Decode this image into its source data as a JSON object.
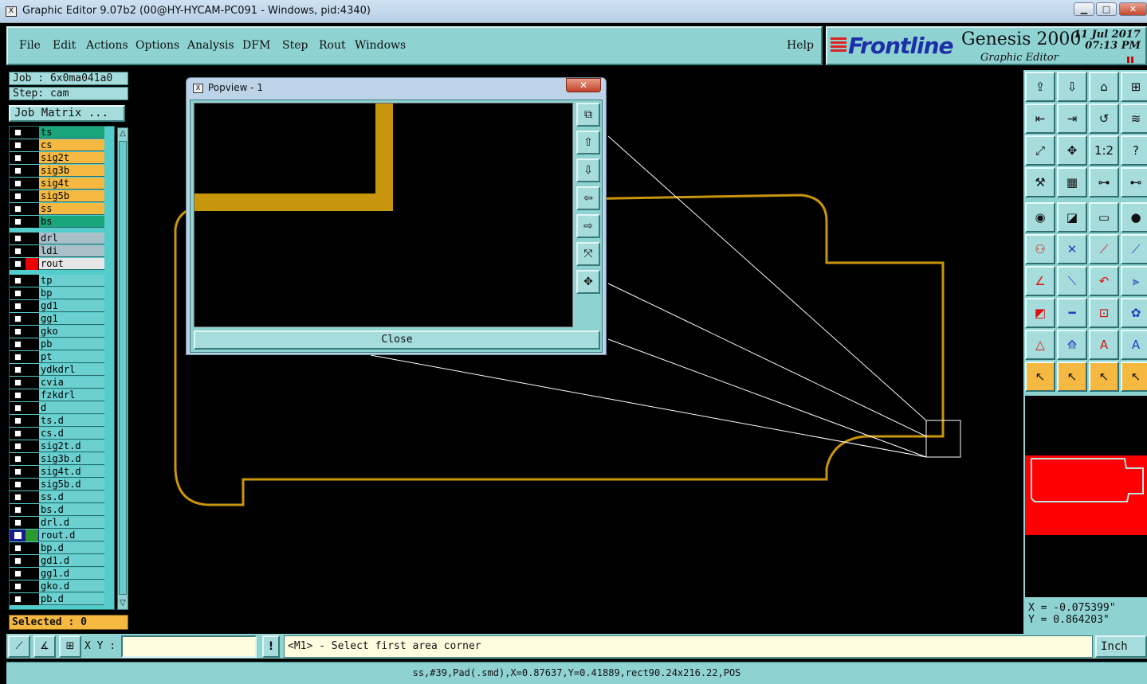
{
  "window": {
    "title": "Graphic Editor 9.07b2 (00@HY-HYCAM-PC091 - Windows, pid:4340)",
    "min_glyph": "▁",
    "max_glyph": "□",
    "close_glyph": "✕"
  },
  "menu": {
    "items": [
      "File",
      "Edit",
      "Actions",
      "Options",
      "Analysis",
      "DFM",
      "Step",
      "Rout",
      "Windows"
    ],
    "help": "Help"
  },
  "brand": {
    "logo": "Frontline",
    "product": "Genesis 2000",
    "subtitle": "Graphic Editor",
    "date": "11 Jul 2017",
    "time": "07:13 PM"
  },
  "job": {
    "job_label": "Job : 6x0ma041a0",
    "step_label": "Step: cam",
    "matrix_button": "Job Matrix ...",
    "selected": "Selected : 0"
  },
  "layers": [
    {
      "name": "ts",
      "color": "#1aa57a",
      "swatch": "#000"
    },
    {
      "name": "cs",
      "color": "#f5b942",
      "swatch": "#000"
    },
    {
      "name": "sig2t",
      "color": "#f5b942",
      "swatch": "#000"
    },
    {
      "name": "sig3b",
      "color": "#f5b942",
      "swatch": "#000"
    },
    {
      "name": "sig4t",
      "color": "#f5b942",
      "swatch": "#000"
    },
    {
      "name": "sig5b",
      "color": "#f5b942",
      "swatch": "#000"
    },
    {
      "name": "ss",
      "color": "#f5b942",
      "swatch": "#000"
    },
    {
      "name": "bs",
      "color": "#1aa57a",
      "swatch": "#000"
    },
    {
      "name": "drl",
      "color": "#a9c0c8",
      "swatch": "#000"
    },
    {
      "name": "ldi",
      "color": "#a9c0c8",
      "swatch": "#000"
    },
    {
      "name": "rout",
      "color": "#e6e6e6",
      "swatch": "#e00"
    },
    {
      "name": "tp",
      "color": "#6cd0d0",
      "swatch": "#000"
    },
    {
      "name": "bp",
      "color": "#6cd0d0",
      "swatch": "#000"
    },
    {
      "name": "gd1",
      "color": "#6cd0d0",
      "swatch": "#000"
    },
    {
      "name": "gg1",
      "color": "#6cd0d0",
      "swatch": "#000"
    },
    {
      "name": "gko",
      "color": "#6cd0d0",
      "swatch": "#000"
    },
    {
      "name": "pb",
      "color": "#6cd0d0",
      "swatch": "#000"
    },
    {
      "name": "pt",
      "color": "#6cd0d0",
      "swatch": "#000"
    },
    {
      "name": "ydkdrl",
      "color": "#6cd0d0",
      "swatch": "#000"
    },
    {
      "name": "cvia",
      "color": "#6cd0d0",
      "swatch": "#000"
    },
    {
      "name": "fzkdrl",
      "color": "#6cd0d0",
      "swatch": "#000"
    },
    {
      "name": "d",
      "color": "#6cd0d0",
      "swatch": "#000"
    },
    {
      "name": "ts.d",
      "color": "#6cd0d0",
      "swatch": "#000"
    },
    {
      "name": "cs.d",
      "color": "#6cd0d0",
      "swatch": "#000"
    },
    {
      "name": "sig2t.d",
      "color": "#6cd0d0",
      "swatch": "#000"
    },
    {
      "name": "sig3b.d",
      "color": "#6cd0d0",
      "swatch": "#000"
    },
    {
      "name": "sig4t.d",
      "color": "#6cd0d0",
      "swatch": "#000"
    },
    {
      "name": "sig5b.d",
      "color": "#6cd0d0",
      "swatch": "#000"
    },
    {
      "name": "ss.d",
      "color": "#6cd0d0",
      "swatch": "#000"
    },
    {
      "name": "bs.d",
      "color": "#6cd0d0",
      "swatch": "#000"
    },
    {
      "name": "drl.d",
      "color": "#6cd0d0",
      "swatch": "#000"
    },
    {
      "name": "rout.d",
      "color": "#6cd0d0",
      "swatch": "#2a9a2a",
      "active": true
    },
    {
      "name": "bp.d",
      "color": "#6cd0d0",
      "swatch": "#000"
    },
    {
      "name": "gd1.d",
      "color": "#6cd0d0",
      "swatch": "#000"
    },
    {
      "name": "gg1.d",
      "color": "#6cd0d0",
      "swatch": "#000"
    },
    {
      "name": "gko.d",
      "color": "#6cd0d0",
      "swatch": "#000"
    },
    {
      "name": "pb.d",
      "color": "#6cd0d0",
      "swatch": "#000"
    }
  ],
  "popview": {
    "title": "Popview - 1",
    "close_label": "Close",
    "close_x": "✕"
  },
  "coords": {
    "x": "X = -0.075399\"",
    "y": "Y =  0.864203\""
  },
  "bottom": {
    "xy_label": "X Y :",
    "xy_value": "",
    "bang": "!",
    "prompt": "<M1> - Select first area corner",
    "unit": "Inch"
  },
  "status": "ss,#39,Pad(.smd),X=0.87637,Y=0.41889,rect90.24x216.22,POS",
  "colors": {
    "panel": "#8fd2d2",
    "trace": "#c8960c",
    "layer_board": "#1aa57a",
    "layer_signal": "#f5b942",
    "minimap": "#ff0000"
  },
  "toolbar_icons": [
    "open-icon",
    "save-icon",
    "home-icon",
    "grid-icon",
    "prev-icon",
    "next-icon",
    "undo-icon",
    "snap-icon",
    "zoom-fit-icon",
    "zoom-center-icon",
    "one-to-two-icon",
    "help-icon",
    "tools-icon",
    "grid-snap-icon",
    "net-icon",
    "net2-icon",
    "record-icon",
    "select-arrow-icon",
    "ruler-icon",
    "pad-icon",
    "connect-icon",
    "delete-icon",
    "line-dot-icon",
    "line-dot2-icon",
    "angle-icon",
    "slash-icon",
    "arc-icon",
    "bracket-icon",
    "node-icon",
    "segment-icon",
    "measure-icon",
    "blob-icon",
    "triangle-icon",
    "tri-up-icon",
    "tri-a-icon",
    "tri-a2-icon",
    "pointer-icon",
    "pointer-box-icon",
    "pointer-rot-icon",
    "pointer-net-icon"
  ],
  "toolbar_glyphs": [
    "⇪",
    "⇩",
    "⌂",
    "⊞",
    "⇤",
    "⇥",
    "↺",
    "≋",
    "⤢",
    "✥",
    "1:2",
    "?",
    "⚒",
    "▦",
    "⊶",
    "⊷",
    "◉",
    "◪",
    "▭",
    "●",
    "⚇",
    "✕",
    "⟋",
    "⟋",
    "∠",
    "⟍",
    "↶",
    "⫸",
    "◩",
    "━",
    "⊡",
    "✿",
    "△",
    "⟰",
    "A",
    "A",
    "↖",
    "↖",
    "↖",
    "↖"
  ]
}
